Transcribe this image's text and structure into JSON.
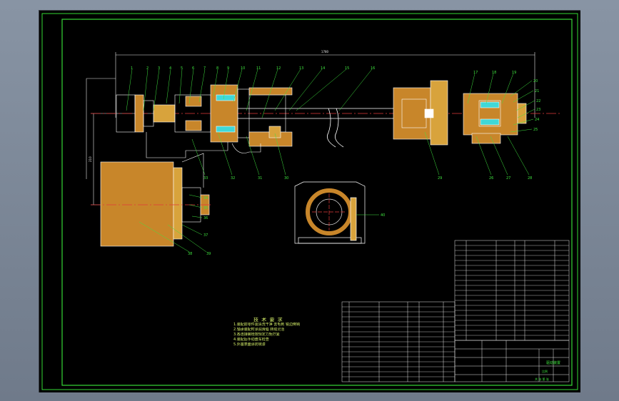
{
  "colors": {
    "frame": "#35d935",
    "outline": "#ffffff",
    "section_fill": "#c8862a",
    "hatch": "#d8a33c",
    "centerline": "#e03a3a",
    "dimension": "#e8e8e8",
    "leader": "#3fe33f",
    "parts": "#c8c840",
    "table_line": "#e8e8e8",
    "table_text": "#3fe33f"
  },
  "part_balloons_top": [
    "1",
    "2",
    "3",
    "4",
    "5",
    "6",
    "7",
    "8",
    "9",
    "10",
    "11",
    "12",
    "13",
    "14",
    "15",
    "16",
    "17",
    "18",
    "19"
  ],
  "part_balloons_right": [
    "20",
    "21",
    "22",
    "23",
    "24",
    "25"
  ],
  "part_balloons_bottom": [
    "26",
    "27",
    "28",
    "29",
    "30",
    "31",
    "32",
    "33",
    "34",
    "35",
    "36",
    "37",
    "38",
    "39",
    "40"
  ],
  "dimensions": {
    "overall_length": "1780",
    "vertical_offset": "210"
  },
  "technical_notes": {
    "title": "技 术 要 求",
    "lines": [
      "1.装配前零件需清洗干净 去毛刺 锐边倒钝",
      "2.轴承装配时涂润滑脂 转动灵活",
      "3.各连接螺栓按规定力矩拧紧",
      "4.装配后手动盘车检查",
      "5.外露表面涂防锈漆"
    ]
  },
  "title_block": {
    "drawing_name": "驱动装置",
    "scale_label": "比例",
    "sheet_label": "共 张 第 张"
  },
  "interface": {
    "icons": [
      "drawing-canvas-icon"
    ]
  }
}
